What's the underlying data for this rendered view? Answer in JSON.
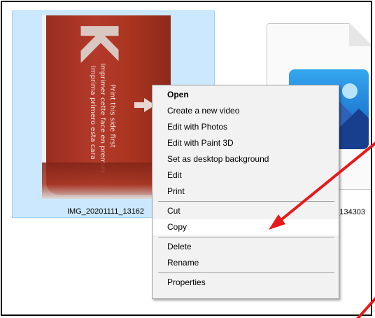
{
  "files": {
    "selected_label": "IMG_20201111_13162",
    "other_label": "1_134303",
    "thumbnail_text": {
      "big_letter": "K",
      "line1": "Print this side first",
      "line2": "Imprimer cette face en premier",
      "line3": "Imprima primero esta cara"
    }
  },
  "context_menu": {
    "items": [
      {
        "label": "Open",
        "bold": true
      },
      {
        "label": "Create a new video"
      },
      {
        "label": "Edit with Photos"
      },
      {
        "label": "Edit with Paint 3D"
      },
      {
        "label": "Set as desktop background"
      },
      {
        "label": "Edit"
      },
      {
        "label": "Print"
      },
      {
        "label": "Cut"
      },
      {
        "label": "Copy",
        "highlighted": true
      },
      {
        "label": "Delete"
      },
      {
        "label": "Rename"
      },
      {
        "label": "Properties"
      }
    ]
  },
  "colors": {
    "selection_bg": "#cce8ff",
    "menu_bg": "#f2f2f2",
    "annotation": "#e8191b"
  }
}
